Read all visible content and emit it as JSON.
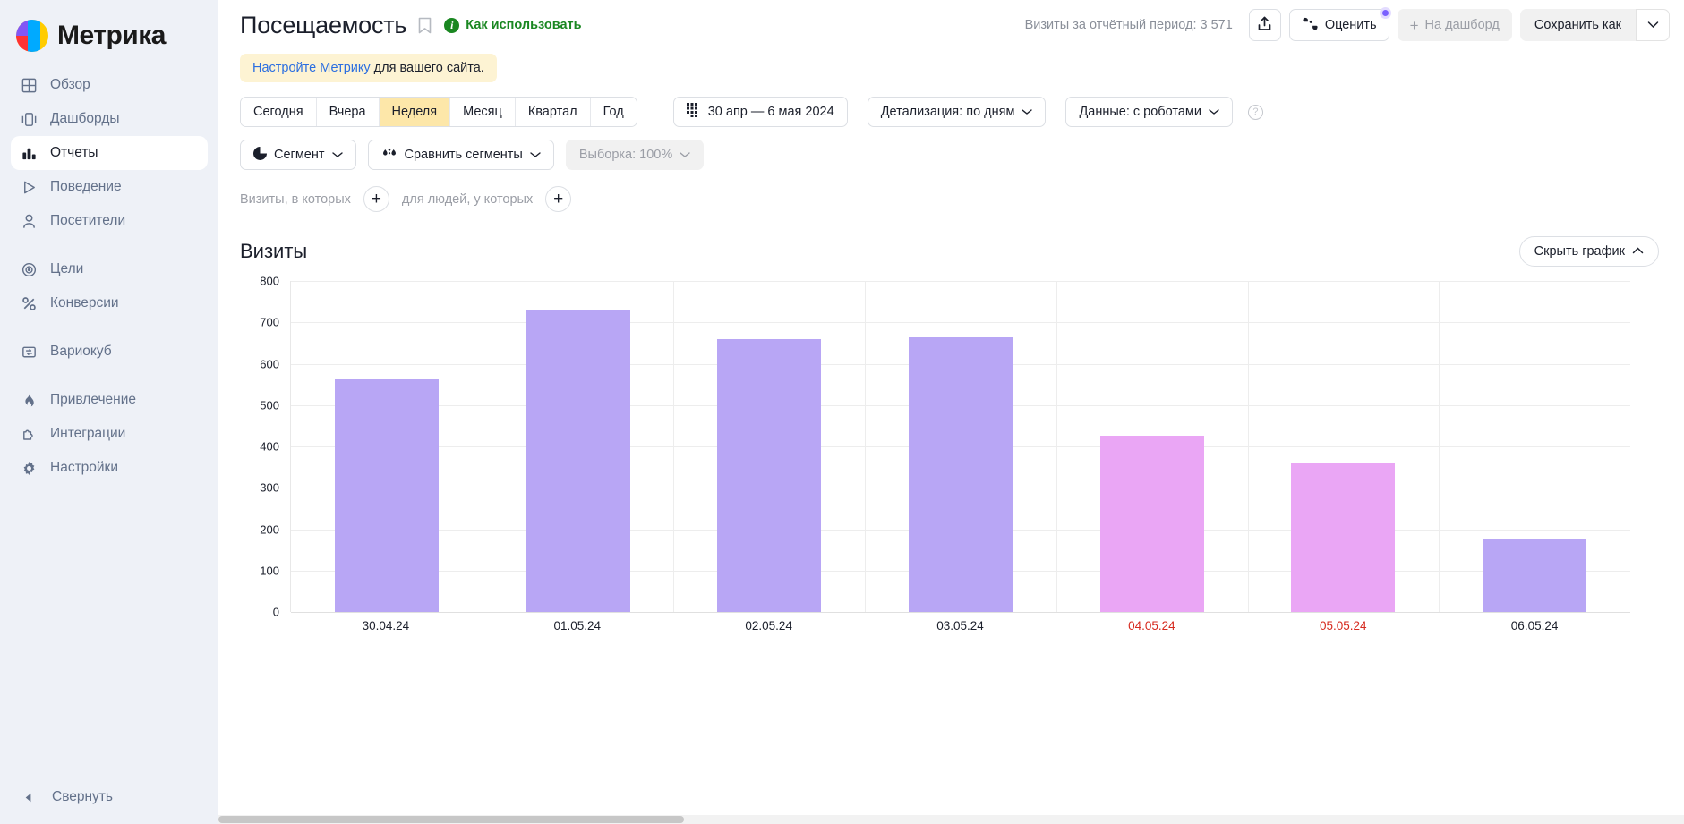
{
  "brand": {
    "name": "Метрика",
    "logo_icon": "metrika-logo-icon"
  },
  "sidebar": {
    "items": [
      {
        "label": "Обзор",
        "icon": "grid-icon",
        "active": false
      },
      {
        "label": "Дашборды",
        "icon": "dashboard-icon",
        "active": false
      },
      {
        "label": "Отчеты",
        "icon": "bar-chart-icon",
        "active": true
      },
      {
        "label": "Поведение",
        "icon": "play-triangle-icon",
        "active": false
      },
      {
        "label": "Посетители",
        "icon": "user-icon",
        "active": false
      },
      {
        "label": "Цели",
        "icon": "target-icon",
        "active": false
      },
      {
        "label": "Конверсии",
        "icon": "percent-icon",
        "active": false
      },
      {
        "label": "Вариокуб",
        "icon": "variocube-icon",
        "active": false
      },
      {
        "label": "Привлечение",
        "icon": "flame-icon",
        "active": false
      },
      {
        "label": "Интеграции",
        "icon": "puzzle-icon",
        "active": false
      },
      {
        "label": "Настройки",
        "icon": "gear-icon",
        "active": false
      }
    ],
    "collapse_label": "Свернуть",
    "collapse_icon": "chevron-left-icon"
  },
  "header": {
    "title": "Посещаемость",
    "bookmark_icon": "bookmark-icon",
    "howto_label": "Как использовать",
    "howto_icon": "info-circle-icon",
    "howto_color": "#1a8721",
    "visits_total": "Визиты за отчётный период: 3 571",
    "share_icon": "share-upload-icon",
    "rate_label": "Оценить",
    "rate_icon": "thumbs-updown-icon",
    "rate_badge_color": "#7b61ff",
    "dashboard_label": "На дашборд",
    "dashboard_icon": "plus-icon",
    "save_as_label": "Сохранить как",
    "save_as_caret_icon": "chevron-down-icon"
  },
  "banner": {
    "link_text": "Настройте Метрику",
    "rest_text": " для вашего сайта.",
    "bg_color": "#fdf3d3",
    "link_color": "#2b6ee0"
  },
  "period_tabs": {
    "items": [
      "Сегодня",
      "Вчера",
      "Неделя",
      "Месяц",
      "Квартал",
      "Год"
    ],
    "active": "Неделя",
    "active_color": "#fde7a9"
  },
  "controls": {
    "date_range": "30 апр — 6 мая 2024",
    "date_icon": "calendar-grid-icon",
    "detail_label": "Детализация: по дням",
    "detail_caret_icon": "chevron-down-icon",
    "data_label": "Данные: с роботами",
    "data_caret_icon": "chevron-down-icon",
    "help_icon": "question-circle-icon",
    "segment_label": "Сегмент",
    "segment_icon": "pie-icon",
    "compare_label": "Сравнить сегменты",
    "compare_icon": "droplets-icon",
    "sampling_label": "Выборка: 100%",
    "sampling_caret_icon": "chevron-down-icon"
  },
  "filters": {
    "visits_label": "Визиты, в которых",
    "visits_add_icon": "plus-icon",
    "people_label": "для людей, у которых",
    "people_add_icon": "plus-icon"
  },
  "chart_panel": {
    "title": "Визиты",
    "hide_label": "Скрыть график",
    "hide_icon": "chevron-up-icon"
  },
  "chart_data": {
    "type": "bar",
    "title": "Визиты",
    "xlabel": "",
    "ylabel": "",
    "ylim": [
      0,
      800
    ],
    "yticks": [
      800,
      700,
      600,
      500,
      400,
      300,
      200,
      100,
      0
    ],
    "grid": true,
    "legend": "none",
    "categories": [
      "30.04.24",
      "01.05.24",
      "02.05.24",
      "03.05.24",
      "04.05.24",
      "05.05.24",
      "06.05.24"
    ],
    "values": [
      562,
      728,
      660,
      663,
      425,
      358,
      175
    ],
    "bar_colors": [
      "#b8a6f5",
      "#b8a6f5",
      "#b8a6f5",
      "#b8a6f5",
      "#eaa6f5",
      "#eaa6f5",
      "#b8a6f5"
    ],
    "weekend_labels": [
      "04.05.24",
      "05.05.24"
    ],
    "weekend_label_color": "#d62a1f",
    "total": "3 571"
  }
}
